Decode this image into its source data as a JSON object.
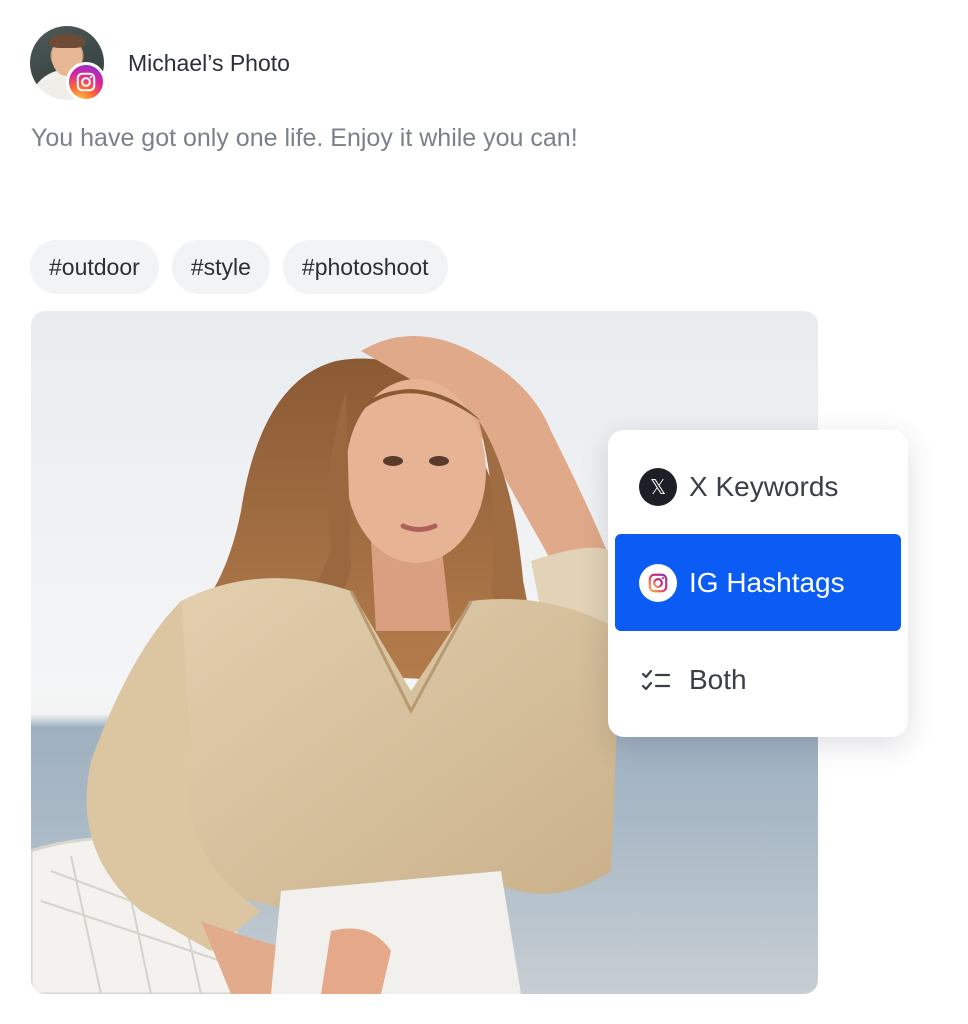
{
  "post": {
    "user_name": "Michael’s Photo",
    "caption": "You have got only one life. Enjoy it while you can!",
    "avatar_icon": "user-avatar",
    "network_badge_icon": "instagram-icon"
  },
  "hashtags": [
    {
      "label": "#outdoor"
    },
    {
      "label": "#style"
    },
    {
      "label": "#photoshoot"
    }
  ],
  "dropdown": {
    "options": [
      {
        "label": "X Keywords",
        "icon": "x-logo-icon",
        "selected": false
      },
      {
        "label": "IG Hashtags",
        "icon": "instagram-icon",
        "selected": true
      },
      {
        "label": "Both",
        "icon": "checklist-icon",
        "selected": false
      }
    ]
  },
  "colors": {
    "selected_option": "#0b5cf5",
    "text_primary": "#2b2f36",
    "text_muted": "#7b818a",
    "tag_background": "#f2f3f5"
  }
}
